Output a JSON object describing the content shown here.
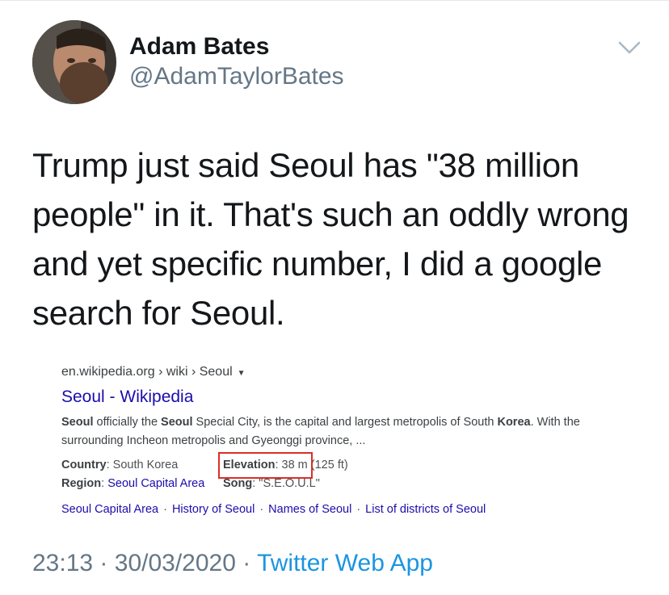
{
  "author": {
    "name": "Adam Bates",
    "handle": "@AdamTaylorBates"
  },
  "tweet": {
    "text": "Trump just said Seoul has \"38 million people\" in it. That's such an oddly wrong and yet specific number, I did a google search for Seoul."
  },
  "search_result": {
    "url": "en.wikipedia.org › wiki › Seoul",
    "title": "Seoul - Wikipedia",
    "snippet": {
      "b1": "Seoul",
      "t1": " officially the ",
      "b2": "Seoul",
      "t2": " Special City, is the capital and largest metropolis of South ",
      "b3": "Korea",
      "t3": ". With the surrounding Incheon metropolis and Gyeonggi province, ..."
    },
    "facts": {
      "country_label": "Country",
      "country_value": ": South Korea",
      "elevation_label": "Elevation",
      "elevation_value": ": 38 m (125 ft)",
      "region_label": "Region",
      "region_value": "Seoul Capital Area",
      "song_label": "Song",
      "song_value": ": \"S.E.O.U.L\""
    },
    "links": [
      "Seoul Capital Area",
      "History of Seoul",
      "Names of Seoul",
      "List of districts of Seoul"
    ],
    "highlight_color": "#d93025"
  },
  "meta": {
    "time": "23:13",
    "date": "30/03/2020",
    "separator": "·",
    "source": "Twitter Web App"
  },
  "icons": {
    "caret": "chevron-down-icon"
  },
  "colors": {
    "text": "#14171a",
    "secondary": "#657786",
    "link": "#1b95e0"
  }
}
